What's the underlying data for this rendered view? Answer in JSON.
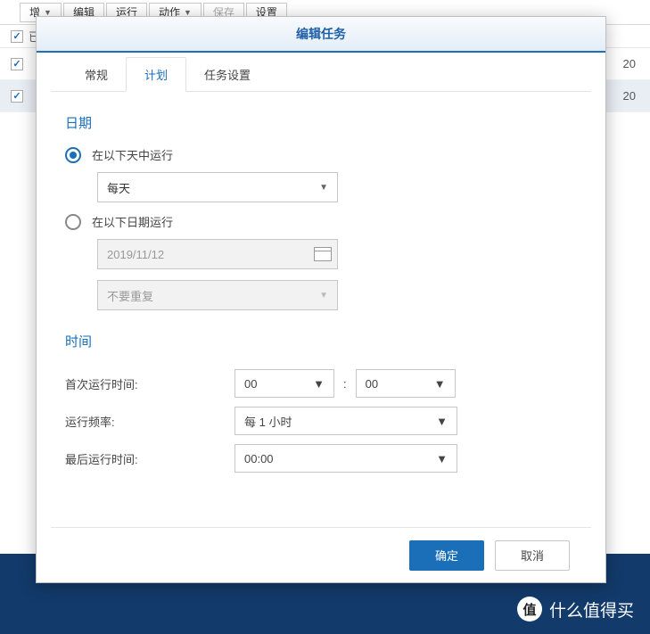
{
  "bg_toolbar": {
    "add": "增",
    "edit": "编辑",
    "run": "运行",
    "action": "动作",
    "save": "保存",
    "settings": "设置"
  },
  "bg_header": {
    "enabled_col": "已"
  },
  "bg_rows": [
    {
      "year": "20"
    },
    {
      "year": "20"
    }
  ],
  "modal": {
    "title": "编辑任务",
    "tabs": {
      "general": "常规",
      "schedule": "计划",
      "task_settings": "任务设置"
    },
    "date_section": {
      "title": "日期",
      "run_on_days_label": "在以下天中运行",
      "days_select": "每天",
      "run_on_date_label": "在以下日期运行",
      "date_value": "2019/11/12",
      "repeat_select": "不要重复"
    },
    "time_section": {
      "title": "时间",
      "first_run_label": "首次运行时间:",
      "first_hour": "00",
      "first_min": "00",
      "freq_label": "运行频率:",
      "freq_value": "每 1 小时",
      "last_run_label": "最后运行时间:",
      "last_run_value": "00:00"
    },
    "footer": {
      "ok": "确定",
      "cancel": "取消"
    }
  },
  "watermark": {
    "badge": "值",
    "text": "什么值得买"
  }
}
